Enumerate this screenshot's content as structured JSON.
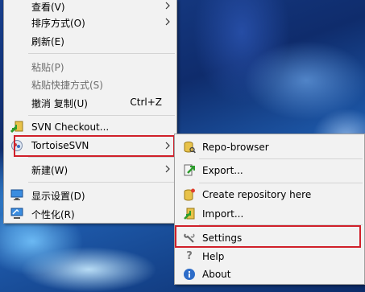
{
  "context_menu": {
    "items": [
      {
        "label": "查看(V)"
      },
      {
        "label": "排序方式(O)"
      },
      {
        "label": "刷新(E)"
      },
      {
        "label": "粘贴(P)"
      },
      {
        "label": "粘贴快捷方式(S)"
      },
      {
        "label": "撤消 复制(U)",
        "shortcut": "Ctrl+Z"
      },
      {
        "label": "SVN Checkout..."
      },
      {
        "label": "TortoiseSVN"
      },
      {
        "label": "新建(W)"
      },
      {
        "label": "显示设置(D)"
      },
      {
        "label": "个性化(R)"
      }
    ]
  },
  "tortoise_submenu": {
    "items": [
      {
        "label": "Repo-browser"
      },
      {
        "label": "Export..."
      },
      {
        "label": "Create repository here"
      },
      {
        "label": "Import..."
      },
      {
        "label": "Settings"
      },
      {
        "label": "Help"
      },
      {
        "label": "About"
      }
    ]
  },
  "colors": {
    "highlight_border": "#d0202a",
    "menu_background": "#f2f2f2"
  }
}
